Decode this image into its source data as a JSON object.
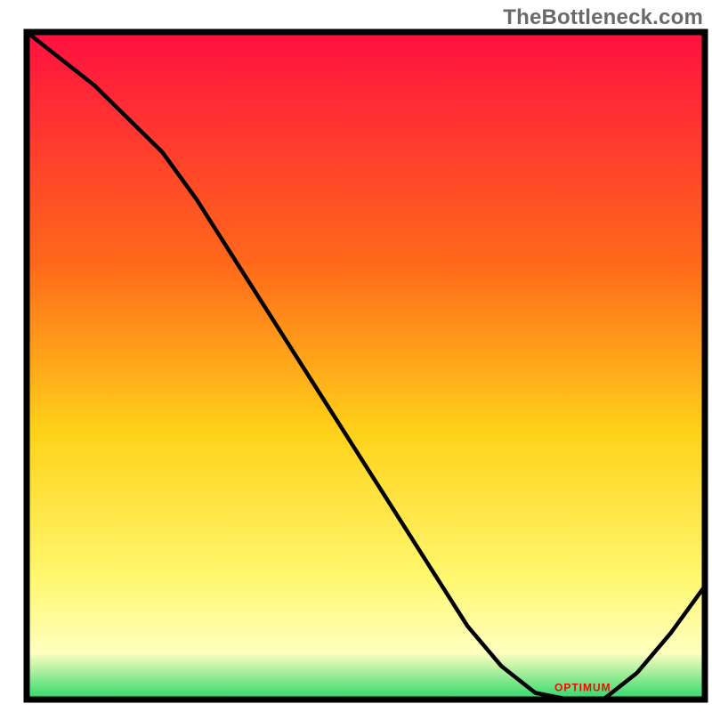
{
  "watermark": "TheBottleneck.com",
  "red_label": "OPTIMUM",
  "chart_data": {
    "type": "line",
    "title": "",
    "xlabel": "",
    "ylabel": "",
    "xlim": [
      0,
      100
    ],
    "ylim": [
      0,
      100
    ],
    "grid": false,
    "legend": null,
    "annotations": [
      {
        "text": "OPTIMUM",
        "x": 82,
        "y": 1,
        "color": "#ff0000"
      }
    ],
    "series": [
      {
        "name": "curve",
        "x": [
          0,
          5,
          10,
          15,
          20,
          25,
          30,
          35,
          40,
          45,
          50,
          55,
          60,
          65,
          70,
          75,
          80,
          85,
          90,
          95,
          100
        ],
        "y": [
          100,
          96,
          92,
          87,
          82,
          75,
          67,
          59,
          51,
          43,
          35,
          27,
          19,
          11,
          5,
          1,
          0,
          0,
          4,
          10,
          17
        ]
      }
    ],
    "background_gradient": {
      "stops": [
        {
          "pct": 0,
          "color": "#ff1040"
        },
        {
          "pct": 35,
          "color": "#ff6a1a"
        },
        {
          "pct": 60,
          "color": "#ffd21a"
        },
        {
          "pct": 82,
          "color": "#fff870"
        },
        {
          "pct": 93,
          "color": "#ffffc0"
        },
        {
          "pct": 100,
          "color": "#2cd86a"
        }
      ]
    }
  }
}
